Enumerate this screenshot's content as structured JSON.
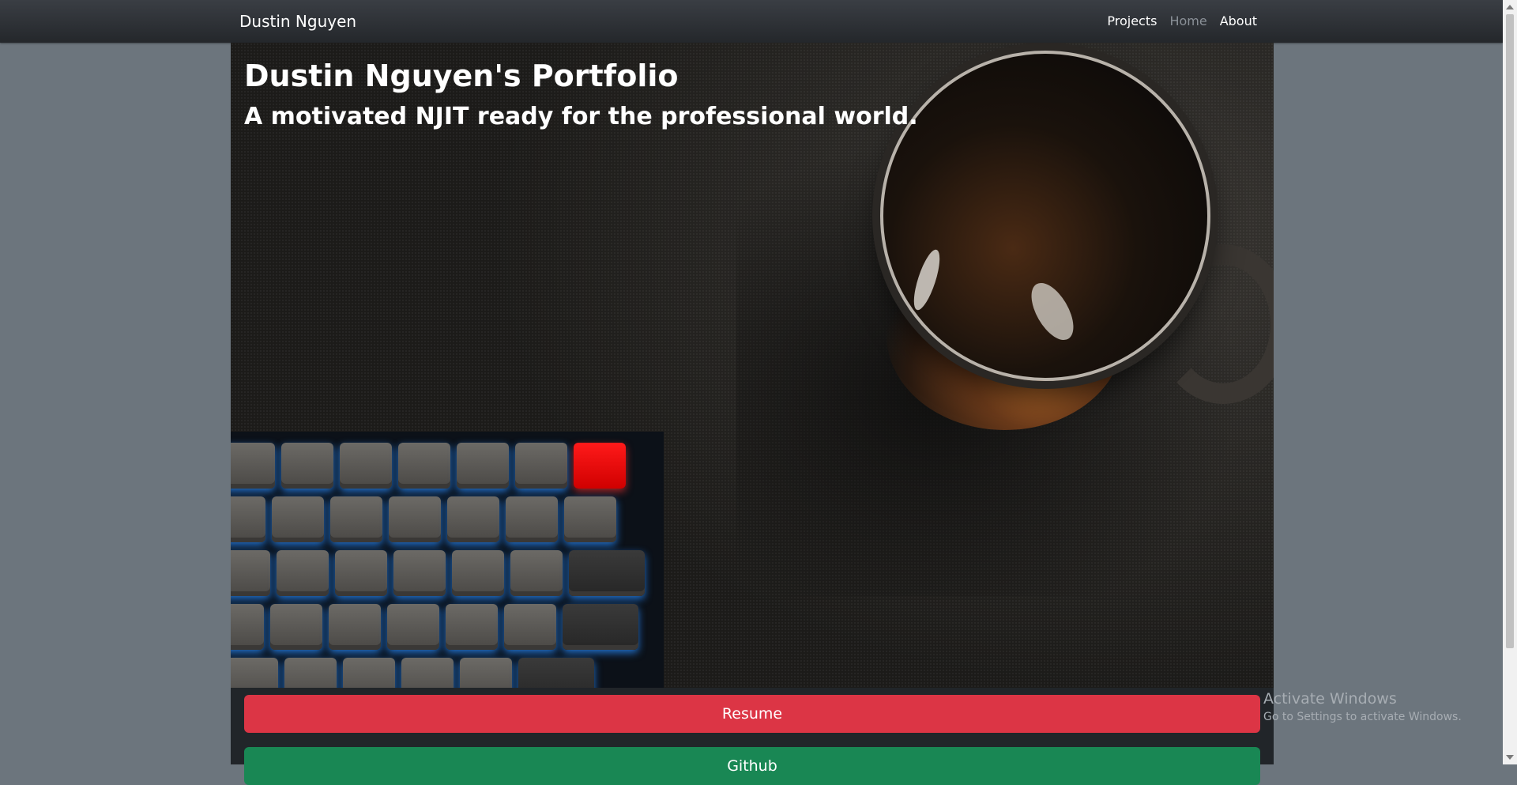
{
  "navbar": {
    "brand": "Dustin Nguyen",
    "links": [
      {
        "label": "Projects",
        "active": false
      },
      {
        "label": "Home",
        "active": true
      },
      {
        "label": "About",
        "active": false
      }
    ]
  },
  "hero": {
    "title": "Dustin Nguyen's Portfolio",
    "subtitle": "A motivated NJIT ready for the professional world.",
    "image_description": "keyboard-and-coffee-mug-photo"
  },
  "buttons": {
    "resume_label": "Resume",
    "github_label": "Github"
  },
  "watermark": {
    "line1": "Activate Windows",
    "line2": "Go to Settings to activate Windows."
  },
  "colors": {
    "page_bg": "#6c757d",
    "navbar_bg": "#2b2f33",
    "resume": "#dc3545",
    "github": "#198754"
  }
}
